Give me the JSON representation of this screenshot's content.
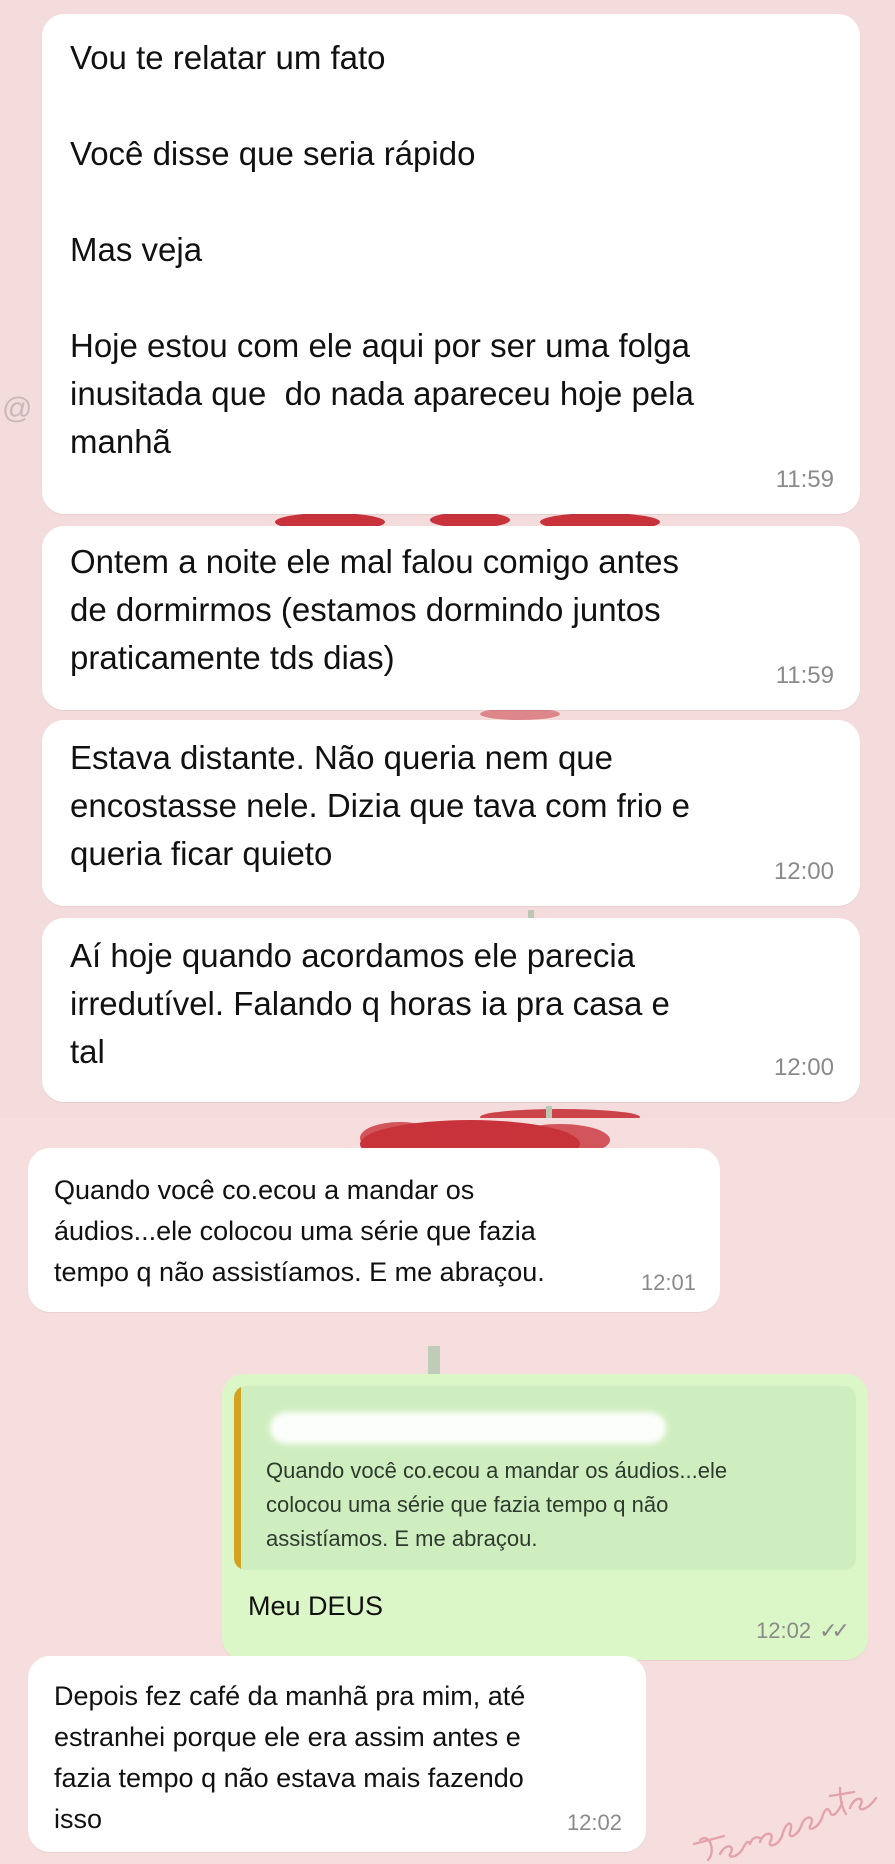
{
  "messages_top": [
    {
      "text": "Vou te relatar um fato\n\nVocê disse que seria rápido\n\nMas veja\n\nHoje estou com ele aqui por ser uma folga\ninusitada que  do nada apareceu hoje pela\nmanhã",
      "time": "11:59"
    },
    {
      "text": "Ontem a noite ele mal falou comigo antes\nde dormirmos (estamos dormindo juntos\npraticamente tds dias)",
      "time": "11:59"
    },
    {
      "text": "Estava distante. Não queria nem que\nencostasse nele. Dizia que tava com frio e\nqueria ficar quieto",
      "time": "12:00"
    },
    {
      "text": "Aí hoje quando acordamos ele parecia\nirredutível. Falando q horas ia pra casa e\ntal",
      "time": "12:00"
    }
  ],
  "messages_bottom": {
    "incoming_1": {
      "text": "Quando você co.ecou a mandar os\náudios...ele colocou uma série que fazia\ntempo q não assistíamos. E me abraçou.",
      "time": "12:01"
    },
    "outgoing_reply": {
      "quoted_text": "Quando você co.ecou a mandar os áudios...ele\ncolocou uma série que fazia tempo q não\nassistíamos. E me abraçou.",
      "text": "Meu DEUS",
      "time": "12:02",
      "status": "read"
    },
    "incoming_2": {
      "text": "Depois fez café da manhã pra mim, até\nestranhei porque ele era assim antes e\nfazia tempo q não estava mais fazendo\nisso",
      "time": "12:02"
    }
  },
  "edge_icon": "@",
  "watermark_text": "terapeuta",
  "colors": {
    "background": "#f6dede",
    "incoming_bubble": "#ffffff",
    "outgoing_bubble": "#dbf7c7",
    "quote_bar": "#d3a21e",
    "flower": "#c8323a"
  }
}
